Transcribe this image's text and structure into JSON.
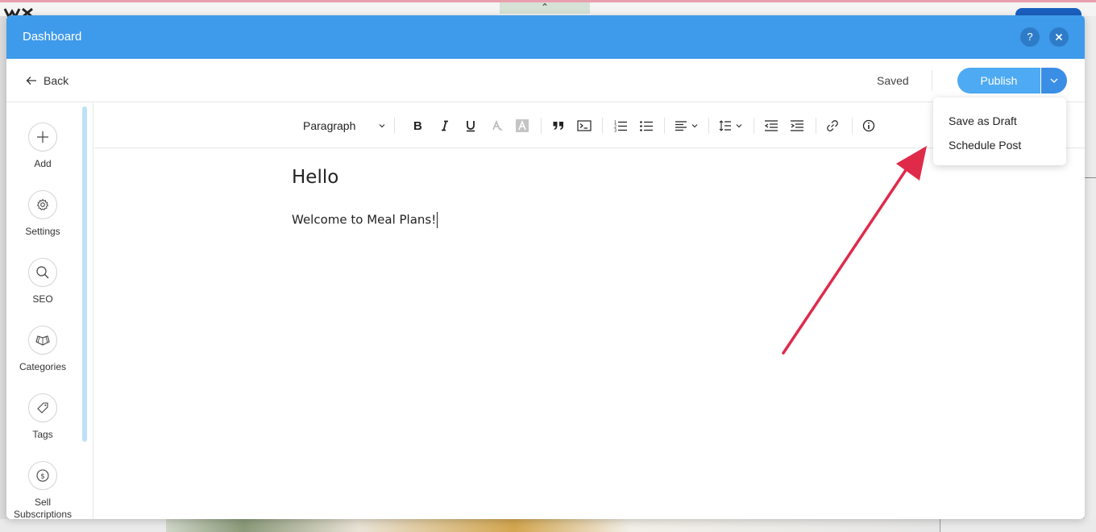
{
  "background": {
    "handle_glyph": "⌃"
  },
  "modal": {
    "title": "Dashboard",
    "help_label": "?",
    "close_label": "✕"
  },
  "topbar": {
    "back_label": "Back",
    "status": "Saved",
    "publish_label": "Publish"
  },
  "publish_menu": {
    "items": [
      {
        "label": "Save as Draft"
      },
      {
        "label": "Schedule Post"
      }
    ]
  },
  "sidebar": {
    "items": [
      {
        "label": "Add",
        "icon": "plus-icon"
      },
      {
        "label": "Settings",
        "icon": "gear-icon"
      },
      {
        "label": "SEO",
        "icon": "search-icon"
      },
      {
        "label": "Categories",
        "icon": "categories-icon"
      },
      {
        "label": "Tags",
        "icon": "tag-icon"
      },
      {
        "label": "Sell Subscriptions",
        "icon": "dollar-icon"
      }
    ]
  },
  "toolbar": {
    "paragraph_label": "Paragraph"
  },
  "editor": {
    "title": "Hello",
    "body": "Welcome to Meal Plans!"
  },
  "colors": {
    "header_bg": "#3e9aea",
    "publish_bg": "#4eaaf2",
    "annotation": "#e02a4a"
  }
}
